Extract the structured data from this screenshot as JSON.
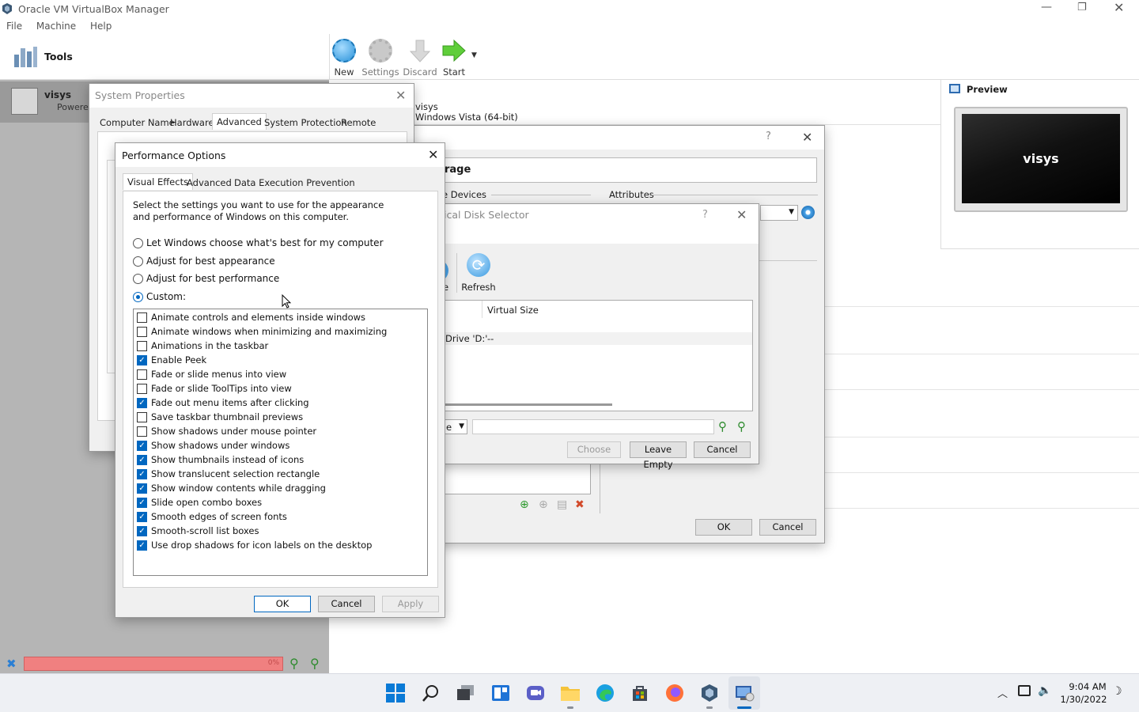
{
  "app": {
    "title": "Oracle VM VirtualBox Manager",
    "menu": [
      "File",
      "Machine",
      "Help"
    ],
    "tools_label": "Tools",
    "toolbar": {
      "new": "New",
      "settings": "Settings",
      "discard": "Discard",
      "start": "Start"
    },
    "vm": {
      "name": "visys",
      "state": "Powered Off"
    },
    "details": {
      "name": "visys",
      "os": "Windows Vista (64-bit)"
    },
    "preview": {
      "label": "Preview",
      "screen_text": "visys"
    }
  },
  "settings_dialog": {
    "storage_label": "rage",
    "devices_label": "e Devices",
    "attributes_label": "Attributes",
    "ok": "OK",
    "cancel": "Cancel"
  },
  "disk_selector": {
    "title": "ical Disk Selector",
    "refresh_label": "Refresh",
    "partial_label": "e",
    "col_virtual_size": "Virtual Size",
    "row_name": "Drive 'D:'",
    "row_size": "--",
    "filter_value": "e",
    "choose": "Choose",
    "leave_empty": "Leave Empty",
    "cancel": "Cancel"
  },
  "system_properties": {
    "title": "System Properties",
    "tabs": [
      "Computer Name",
      "Hardware",
      "Advanced",
      "System Protection",
      "Remote"
    ],
    "selected_tab": "Advanced"
  },
  "performance_options": {
    "title": "Performance Options",
    "tabs": [
      "Visual Effects",
      "Advanced",
      "Data Execution Prevention"
    ],
    "selected_tab": "Visual Effects",
    "description": "Select the settings you want to use for the appearance and performance of Windows on this computer.",
    "radios": [
      {
        "label": "Let Windows choose what's best for my computer",
        "checked": false
      },
      {
        "label": "Adjust for best appearance",
        "checked": false
      },
      {
        "label": "Adjust for best performance",
        "checked": false
      },
      {
        "label": "Custom:",
        "checked": true
      }
    ],
    "effects": [
      {
        "label": "Animate controls and elements inside windows",
        "checked": false
      },
      {
        "label": "Animate windows when minimizing and maximizing",
        "checked": false
      },
      {
        "label": "Animations in the taskbar",
        "checked": false
      },
      {
        "label": "Enable Peek",
        "checked": true
      },
      {
        "label": "Fade or slide menus into view",
        "checked": false
      },
      {
        "label": "Fade or slide ToolTips into view",
        "checked": false
      },
      {
        "label": "Fade out menu items after clicking",
        "checked": true
      },
      {
        "label": "Save taskbar thumbnail previews",
        "checked": false
      },
      {
        "label": "Show shadows under mouse pointer",
        "checked": false
      },
      {
        "label": "Show shadows under windows",
        "checked": true
      },
      {
        "label": "Show thumbnails instead of icons",
        "checked": true
      },
      {
        "label": "Show translucent selection rectangle",
        "checked": true
      },
      {
        "label": "Show window contents while dragging",
        "checked": true
      },
      {
        "label": "Slide open combo boxes",
        "checked": true
      },
      {
        "label": "Smooth edges of screen fonts",
        "checked": true
      },
      {
        "label": "Smooth-scroll list boxes",
        "checked": true
      },
      {
        "label": "Use drop shadows for icon labels on the desktop",
        "checked": true
      }
    ],
    "ok": "OK",
    "cancel": "Cancel",
    "apply": "Apply"
  },
  "statusbar": {
    "progress_text": "0%"
  },
  "taskbar": {
    "time": "9:04 AM",
    "date": "1/30/2022",
    "icons": [
      "start-icon",
      "search-icon",
      "task-view-icon",
      "widgets-icon",
      "chat-icon",
      "file-explorer-icon",
      "edge-icon",
      "store-icon",
      "firefox-icon",
      "virtualbox-icon",
      "system-properties-icon"
    ]
  },
  "colors": {
    "accent": "#0067c0",
    "taskbar_bg": "#eef0f4",
    "progress_red": "#f08080"
  }
}
